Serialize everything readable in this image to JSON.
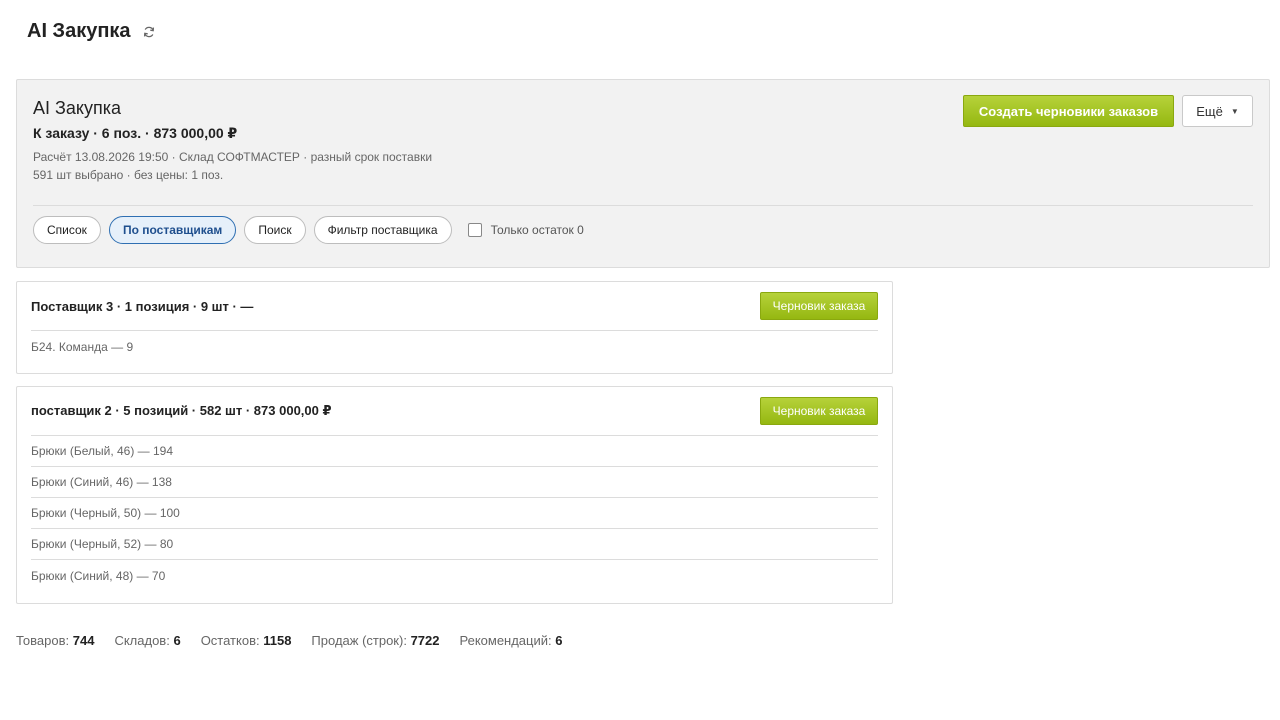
{
  "page": {
    "title": "AI Закупка",
    "refresh_icon": "refresh-icon"
  },
  "summary": {
    "title": "AI Закупка",
    "total": "К заказу · 6 поз. · 873 000,00 ₽",
    "meta_line1": "Расчёт 13.08.2026 19:50 · Склад СОФТМАСТЕР · разный срок поставки",
    "meta_line2": "591 шт выбрано · без цены: 1 поз.",
    "create_button": "Создать черновики заказов",
    "more_button": "Ещё",
    "more_icon": "caret-down-icon"
  },
  "filters": {
    "chips": [
      {
        "label": "Список",
        "active": false
      },
      {
        "label": "По поставщикам",
        "active": true
      },
      {
        "label": "Поиск",
        "active": false
      },
      {
        "label": "Фильтр поставщика",
        "active": false
      }
    ],
    "only_zero_label": "Только остаток 0",
    "only_zero_checked": false
  },
  "suppliers": [
    {
      "title": "Поставщик 3 · 1 позиция · 9 шт · —",
      "button": "Черновик заказа",
      "items": [
        "Б24. Команда — 9"
      ]
    },
    {
      "title": "поставщик 2 · 5 позиций · 582 шт · 873 000,00 ₽",
      "button": "Черновик заказа",
      "items": [
        "Брюки (Белый, 46) — 194",
        "Брюки (Синий, 46) — 138",
        "Брюки (Черный, 50) — 100",
        "Брюки (Черный, 52) — 80",
        "Брюки (Синий, 48) — 70"
      ]
    }
  ],
  "stats": [
    {
      "label": "Товаров:",
      "value": "744"
    },
    {
      "label": "Складов:",
      "value": "6"
    },
    {
      "label": "Остатков:",
      "value": "1158"
    },
    {
      "label": "Продаж (строк):",
      "value": "7722"
    },
    {
      "label": "Рекомендаций:",
      "value": "6"
    }
  ],
  "colors": {
    "accent_green": "#9cbf1a",
    "active_chip_blue": "#2f6fb2"
  }
}
